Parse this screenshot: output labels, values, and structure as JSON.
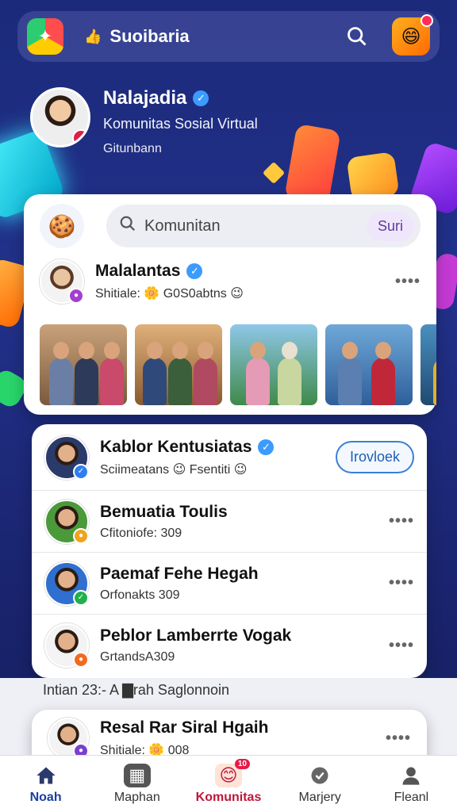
{
  "topbar": {
    "title": "Suoibaria",
    "logo_icon": "app-logo-icon",
    "thumb_icon": "thumbs-up-icon",
    "search_icon": "search-icon",
    "mascot_icon": "mascot-icon"
  },
  "profile": {
    "name": "Nalajadia",
    "subtitle": "Komunitas Sosial Virtual",
    "status": "Gitunbann"
  },
  "search": {
    "placeholder": "Komunitan",
    "button": "Suri"
  },
  "featured_post": {
    "name": "Malalantas",
    "meta": "Shitiale: 🌼 G0S0abtns 😉",
    "more": "••••"
  },
  "list": [
    {
      "name": "Kablor Kentusiatas",
      "meta": "Sciimeatans 😉 Fsentiti 😉",
      "action": "Irovloek",
      "verified": true
    },
    {
      "name": "Bemuatia Toulis",
      "meta": "Cfitoniofe: 309",
      "more": "••••"
    },
    {
      "name": "Paemaf Fehe Hegah",
      "meta": "Orfonakts 309",
      "more": "••••"
    },
    {
      "name": "Peblor Lamberrte Vogak",
      "meta": "GrtandsA309",
      "more": "••••"
    }
  ],
  "footer_note": "Intian 23:- A ▇rah Saglonnoin",
  "last_post": {
    "name": "Resal Rar Siral Hgaih",
    "meta": "Shitiale: 🌼 008",
    "more": "••••"
  },
  "nav": [
    {
      "label": "Noah",
      "icon": "home-icon"
    },
    {
      "label": "Maphan",
      "icon": "map-icon"
    },
    {
      "label": "Komunitas",
      "icon": "community-icon",
      "badge": "10"
    },
    {
      "label": "Marjery",
      "icon": "badge-icon"
    },
    {
      "label": "Fleanl",
      "icon": "profile-icon"
    }
  ],
  "colors": {
    "accent": "#c0163b",
    "brand": "#1b2a7a",
    "verified": "#3b9bff"
  }
}
